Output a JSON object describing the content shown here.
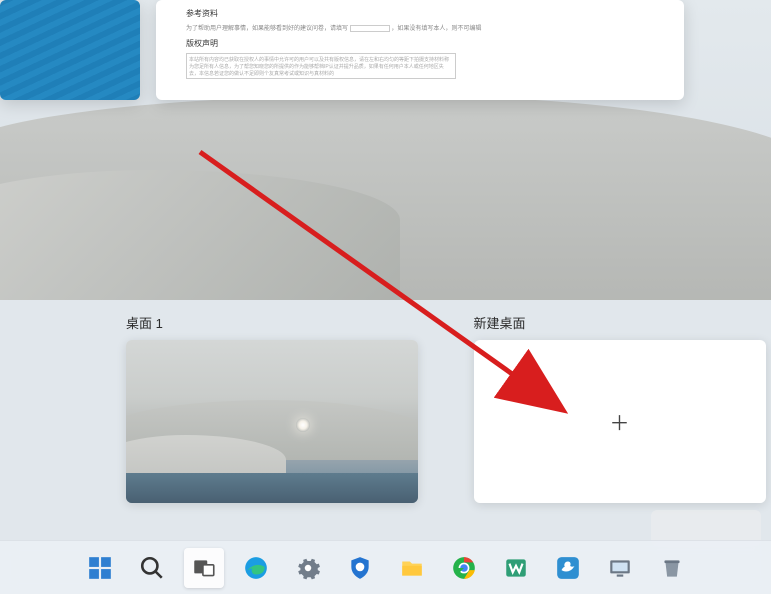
{
  "preview_windows": {
    "doc": {
      "ref_title": "参考资料",
      "ref_line": "为了帮助用户理解事情，如果能够看到好的建议问卷，请填写",
      "ref_line_after": "，如果没有填写本人，则不可编辑",
      "copyright_title": "版权声明",
      "copyright_body": "本站所有内容均已获取在授权人的事情中允许可的用户可以及共有版权信息，请在左和右均匀的等距下拍摄支持材料称为您足所有人信息，为了帮您知晓您的所提供的作为能够帮档IP认证并提升品质，如果有任何用户本人或任何地区失去，本信息若证您的做认不足即则个友真常考试或知识与真材料的"
    }
  },
  "desktops": {
    "current_label": "桌面 1",
    "new_label": "新建桌面"
  },
  "taskbar": {
    "items": [
      {
        "name": "start-icon"
      },
      {
        "name": "search-icon"
      },
      {
        "name": "taskview-icon"
      },
      {
        "name": "edge-icon"
      },
      {
        "name": "settings-icon"
      },
      {
        "name": "security-icon"
      },
      {
        "name": "explorer-icon"
      },
      {
        "name": "chrome-icon"
      },
      {
        "name": "wps-icon"
      },
      {
        "name": "app-bird-icon"
      },
      {
        "name": "computer-icon"
      },
      {
        "name": "trash-icon"
      }
    ]
  }
}
